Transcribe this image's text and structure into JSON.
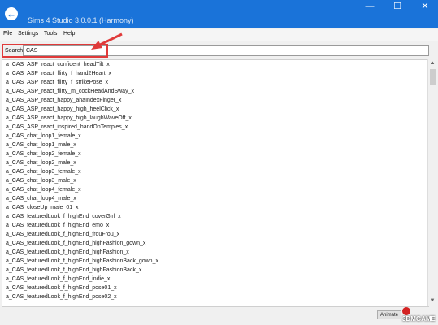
{
  "titlebar": {
    "title": "Sims 4 Studio 3.0.0.1 (Harmony)",
    "back_icon": "back-arrow-icon",
    "controls": [
      "—",
      "☐",
      "✕"
    ]
  },
  "menu": {
    "items": [
      "File",
      "Settings",
      "Tools",
      "Help"
    ]
  },
  "search": {
    "label": "Search:",
    "value": "CAS"
  },
  "list": {
    "items": [
      "a_CAS_ASP_react_confident_headTilt_x",
      "a_CAS_ASP_react_flirty_f_hand2Heart_x",
      "a_CAS_ASP_react_flirty_f_strikePose_x",
      "a_CAS_ASP_react_flirty_m_cockHeadAndSway_x",
      "a_CAS_ASP_react_happy_ahaIndexFinger_x",
      "a_CAS_ASP_react_happy_high_heelClick_x",
      "a_CAS_ASP_react_happy_high_laughWaveOff_x",
      "a_CAS_ASP_react_inspired_handOnTemples_x",
      "a_CAS_chat_loop1_female_x",
      "a_CAS_chat_loop1_male_x",
      "a_CAS_chat_loop2_female_x",
      "a_CAS_chat_loop2_male_x",
      "a_CAS_chat_loop3_female_x",
      "a_CAS_chat_loop3_male_x",
      "a_CAS_chat_loop4_female_x",
      "a_CAS_chat_loop4_male_x",
      "a_CAS_closeUp_male_01_x",
      "a_CAS_featuredLook_f_highEnd_coverGirl_x",
      "a_CAS_featuredLook_f_highEnd_emo_x",
      "a_CAS_featuredLook_f_highEnd_frouFrou_x",
      "a_CAS_featuredLook_f_highEnd_highFashion_gown_x",
      "a_CAS_featuredLook_f_highEnd_highFashion_x",
      "a_CAS_featuredLook_f_highEnd_highFashionBack_gown_x",
      "a_CAS_featuredLook_f_highEnd_highFashionBack_x",
      "a_CAS_featuredLook_f_highEnd_indie_x",
      "a_CAS_featuredLook_f_highEnd_pose01_x",
      "a_CAS_featuredLook_f_highEnd_pose02_x"
    ]
  },
  "colors": {
    "titlebar": "#1a73d9",
    "highlight": "#e03a3a"
  },
  "footer": {
    "button_label": "Animate",
    "watermark": "3DMGAME"
  }
}
